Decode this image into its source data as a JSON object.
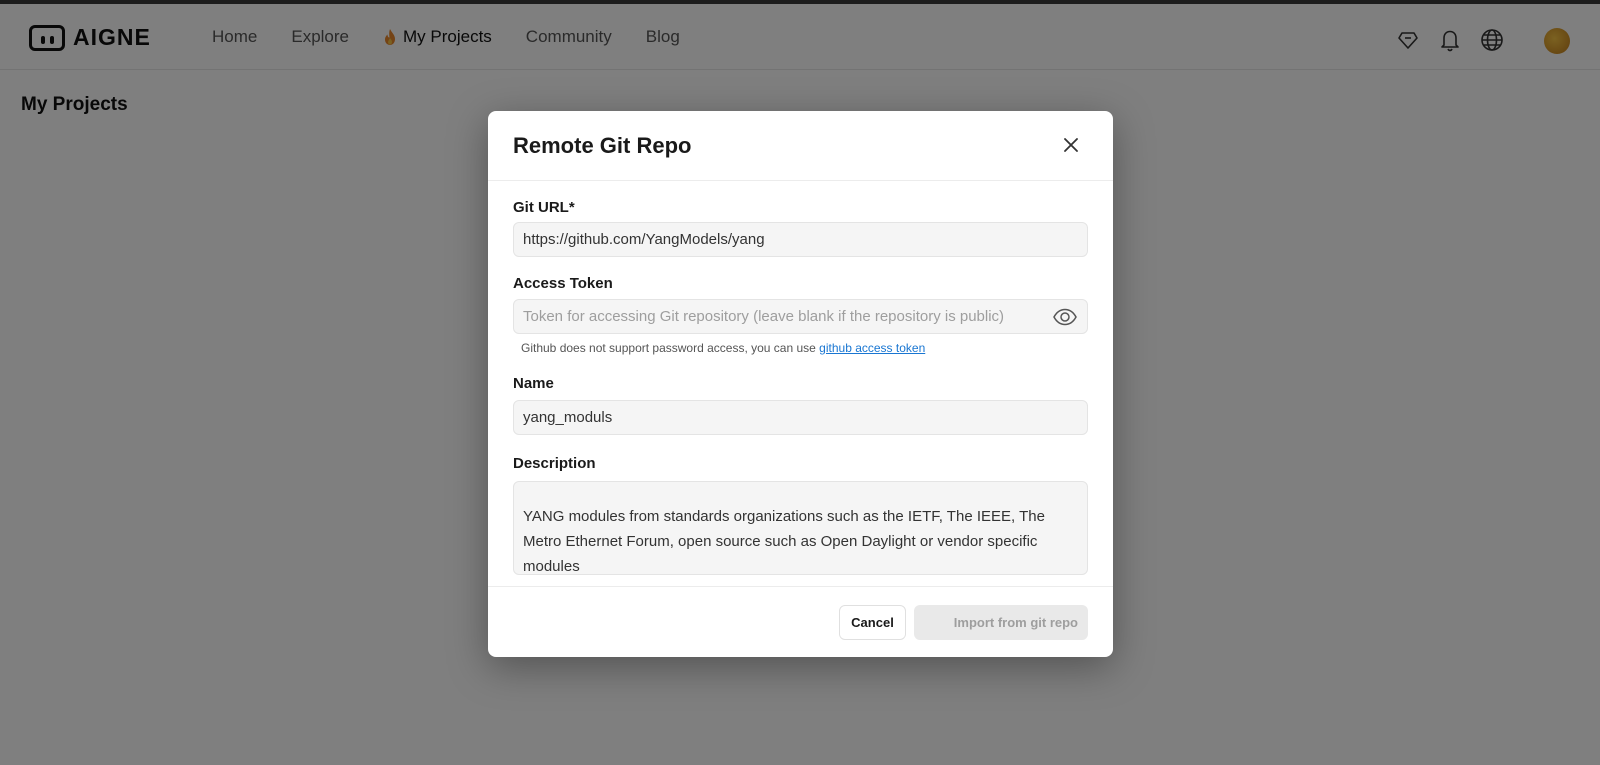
{
  "header": {
    "logo_text": "AIGNE",
    "nav": [
      {
        "label": "Home"
      },
      {
        "label": "Explore"
      },
      {
        "label": "My Projects",
        "icon": "flame-icon",
        "active": true
      },
      {
        "label": "Community"
      },
      {
        "label": "Blog"
      }
    ],
    "icons": [
      "diamond-icon",
      "bell-icon",
      "globe-icon",
      "avatar"
    ]
  },
  "page": {
    "title": "My Projects"
  },
  "dialog": {
    "title": "Remote Git Repo",
    "git_url": {
      "label": "Git URL*",
      "value": "https://github.com/YangModels/yang"
    },
    "access_token": {
      "label": "Access Token",
      "placeholder": "Token for accessing Git repository (leave blank if the repository is public)",
      "hint": "Github does not support password access, you can use ",
      "hint_link": "github access token"
    },
    "name": {
      "label": "Name",
      "value": "yang_moduls"
    },
    "description": {
      "label": "Description",
      "value": "YANG modules from standards organizations such as the IETF, The IEEE, The Metro Ethernet Forum, open source such as Open Daylight or vendor specific modules"
    },
    "cancel_label": "Cancel",
    "import_label": "Import from git repo"
  },
  "colors": {
    "link": "#1976d2",
    "overlay": "rgba(0,0,0,0.5)"
  }
}
